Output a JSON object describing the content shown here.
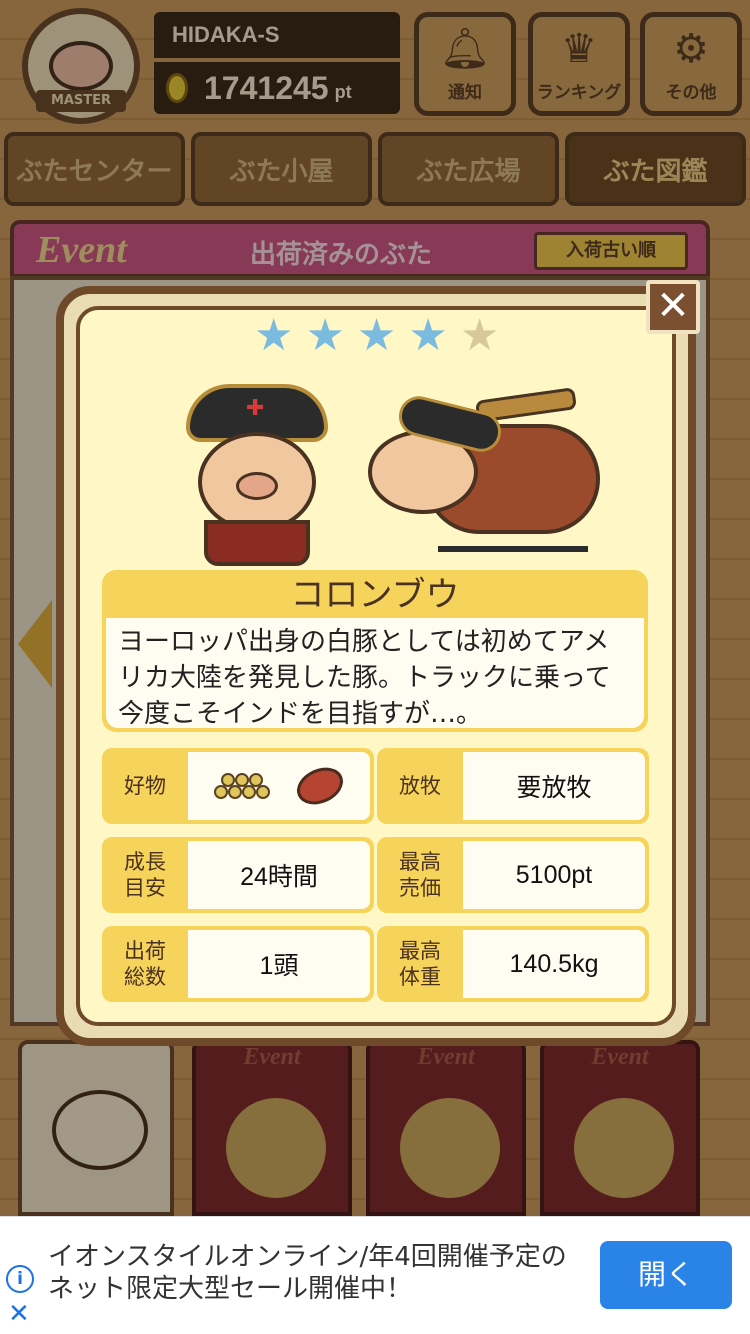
{
  "user": {
    "badge_label": "MASTER",
    "name": "HIDAKA-S",
    "points": "1741245",
    "points_unit": "pt"
  },
  "top_buttons": [
    {
      "label": "通知",
      "icon": "bell-icon"
    },
    {
      "label": "ランキング",
      "icon": "crown-icon"
    },
    {
      "label": "その他",
      "icon": "gear-icon"
    }
  ],
  "nav_tabs": [
    "ぶたセンター",
    "ぶた小屋",
    "ぶた広場",
    "ぶた図鑑"
  ],
  "event_header": {
    "word": "Event",
    "title": "出荷済みのぶた",
    "sort_label": "入荷古い順"
  },
  "bottom_tabs": [
    {
      "label": "Event"
    },
    {
      "label": "Event"
    },
    {
      "label": "Event"
    }
  ],
  "modal": {
    "close_icon": "✕",
    "rating": 4,
    "rating_max": 5,
    "pig_name": "コロンブウ",
    "description": "ヨーロッパ出身の白豚としては初めてアメリカ大陸を発見した豚。トラックに乗って今度こそインドを目指すが…。",
    "stats": {
      "favorite": {
        "label": "好物",
        "items": [
          "grain-icon",
          "sweet-potato-icon"
        ]
      },
      "grazing": {
        "label": "放牧",
        "value": "要放牧"
      },
      "growth": {
        "label": "成長\n目安",
        "value": "24時間"
      },
      "max_price": {
        "label": "最高\n売価",
        "value": "5100pt"
      },
      "shipped": {
        "label": "出荷\n総数",
        "value": "1頭"
      },
      "max_weight": {
        "label": "最高\n体重",
        "value": "140.5kg"
      }
    }
  },
  "ad": {
    "text": "イオンスタイルオンライン/年4回開催予定のネット限定大型セール開催中！",
    "button": "開く",
    "info_icon": "i",
    "close_icon": "✕"
  },
  "colors": {
    "accent_yellow": "#f6d35a",
    "modal_bg": "#fff8c6",
    "star_on": "#7bbbe0",
    "star_off": "#d8c89c",
    "ad_button": "#2a84e8"
  }
}
